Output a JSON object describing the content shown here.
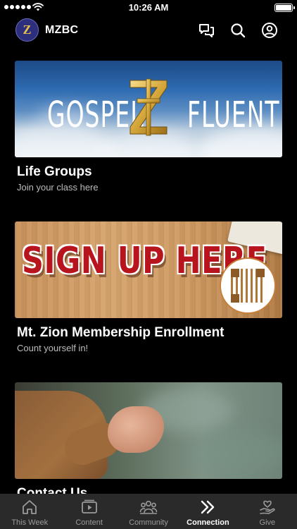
{
  "status_bar": {
    "time": "10:26 AM",
    "signal_bars": 5,
    "battery_level": 1.0
  },
  "header": {
    "avatar_letter": "Z",
    "app_title": "MZBC",
    "icons": [
      "chat-icon",
      "search-icon",
      "profile-icon"
    ]
  },
  "cards": [
    {
      "image_text_left": "GOSPEL",
      "image_text_right": "FLUENT",
      "title": "Life Groups",
      "subtitle": "Join your class here"
    },
    {
      "image_text": "SIGN UP HERE",
      "title": "Mt. Zion Membership Enrollment",
      "subtitle": "Count yourself in!"
    },
    {
      "title": "Contact Us"
    }
  ],
  "bottom_nav": {
    "active": "Connection",
    "items": [
      {
        "label": "This Week",
        "icon": "home-icon"
      },
      {
        "label": "Content",
        "icon": "video-icon"
      },
      {
        "label": "Community",
        "icon": "people-icon"
      },
      {
        "label": "Connection",
        "icon": "chevrons-right-icon"
      },
      {
        "label": "Give",
        "icon": "give-heart-hand-icon"
      }
    ]
  },
  "colors": {
    "background": "#000000",
    "nav_background": "#2a2a2a",
    "nav_inactive": "#9b9b9b",
    "nav_active": "#ffffff",
    "avatar_bg": "#2d2f7c",
    "brand_gold": "#e6bf4a",
    "signup_red": "#b8141e"
  }
}
